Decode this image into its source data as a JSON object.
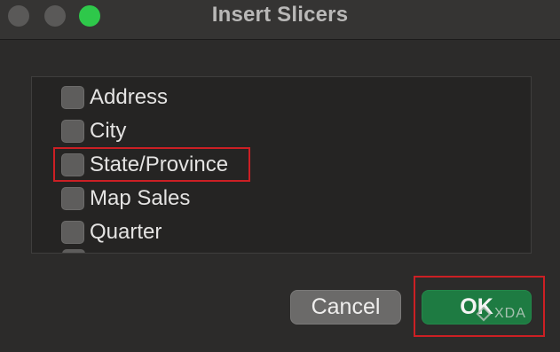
{
  "window": {
    "title": "Insert Slicers"
  },
  "fields": [
    {
      "label": "Address",
      "checked": false
    },
    {
      "label": "City",
      "checked": false
    },
    {
      "label": "State/Province",
      "checked": false
    },
    {
      "label": "Map Sales",
      "checked": false
    },
    {
      "label": "Quarter",
      "checked": false
    }
  ],
  "buttons": {
    "cancel_label": "Cancel",
    "ok_label": "OK"
  },
  "watermark": {
    "text": "XDA"
  },
  "colors": {
    "highlight": "#cc1f24",
    "ok_button": "#1e7b42",
    "zoom_button": "#2ec84a"
  }
}
